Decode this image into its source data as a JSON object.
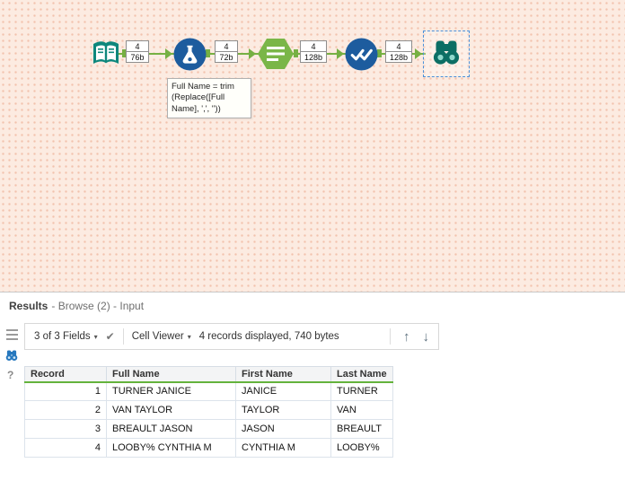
{
  "colors": {
    "canvas_bg": "#fcebe1",
    "canvas_dot": "#f2c2ad",
    "connector_green": "#76b043",
    "tool_blue": "#1d5c9e",
    "tool_teal": "#0e877c",
    "hex_green": "#7ab648",
    "browse_teal": "#0c6e64",
    "selection_blue": "#4a90d9",
    "header_underline": "#64b33c"
  },
  "canvas": {
    "tools": [
      {
        "icon": "input-data-book-icon",
        "count": "4",
        "size": "76b"
      },
      {
        "icon": "formula-flask-icon",
        "count": "4",
        "size": "72b"
      },
      {
        "icon": "summarize-hexagon-icon",
        "count": "4",
        "size": "128b"
      },
      {
        "icon": "unique-checkmarks-icon",
        "count": "4",
        "size": "128b"
      },
      {
        "icon": "browse-binoculars-icon"
      }
    ],
    "annotation": "Full Name = trim\n(Replace([Full\nName], ',', ''))"
  },
  "results": {
    "title": "Results",
    "subtitle": "- Browse (2) - Input",
    "toolbar": {
      "fields_dropdown": "3 of 3 Fields",
      "cell_viewer": "Cell Viewer",
      "status": "4 records displayed, 740 bytes",
      "caret": "▾",
      "check": "✔",
      "up_arrow": "↑",
      "down_arrow": "↓",
      "help": "?"
    },
    "table": {
      "columns": [
        "Record",
        "Full Name",
        "First Name",
        "Last Name"
      ],
      "rows": [
        [
          "1",
          "TURNER JANICE",
          "JANICE",
          "TURNER"
        ],
        [
          "2",
          "VAN TAYLOR",
          "TAYLOR",
          "VAN"
        ],
        [
          "3",
          "BREAULT JASON",
          "JASON",
          "BREAULT"
        ],
        [
          "4",
          "LOOBY% CYNTHIA M",
          "CYNTHIA M",
          "LOOBY%"
        ]
      ]
    }
  }
}
